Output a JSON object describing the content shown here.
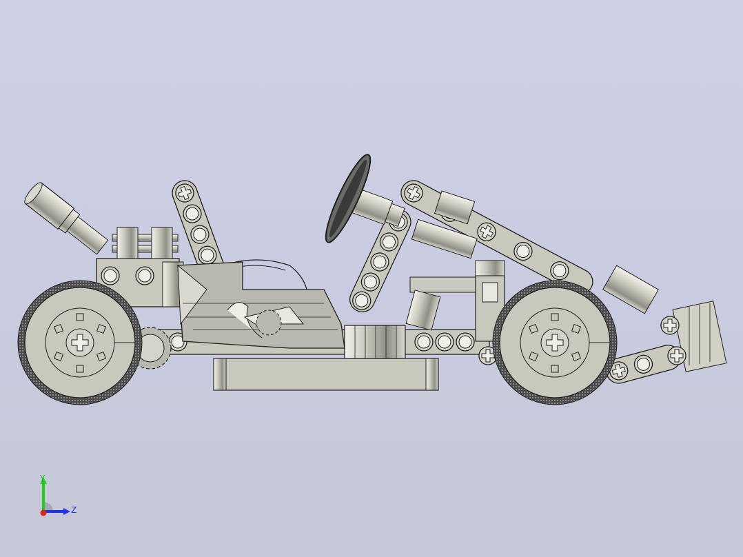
{
  "viewport": {
    "background_top": "#cfd0e6",
    "background_bottom": "#c5c8d6"
  },
  "model": {
    "part_fill": "#c8c8bd",
    "part_shade": "#9a9a90",
    "outline": "#1e1e1e",
    "tire": "#3a3a3a"
  },
  "triad": {
    "y_label": "Y",
    "z_label": "Z",
    "y_color": "#22cc22",
    "z_color": "#2233dd",
    "x_color": "#dd2222"
  }
}
